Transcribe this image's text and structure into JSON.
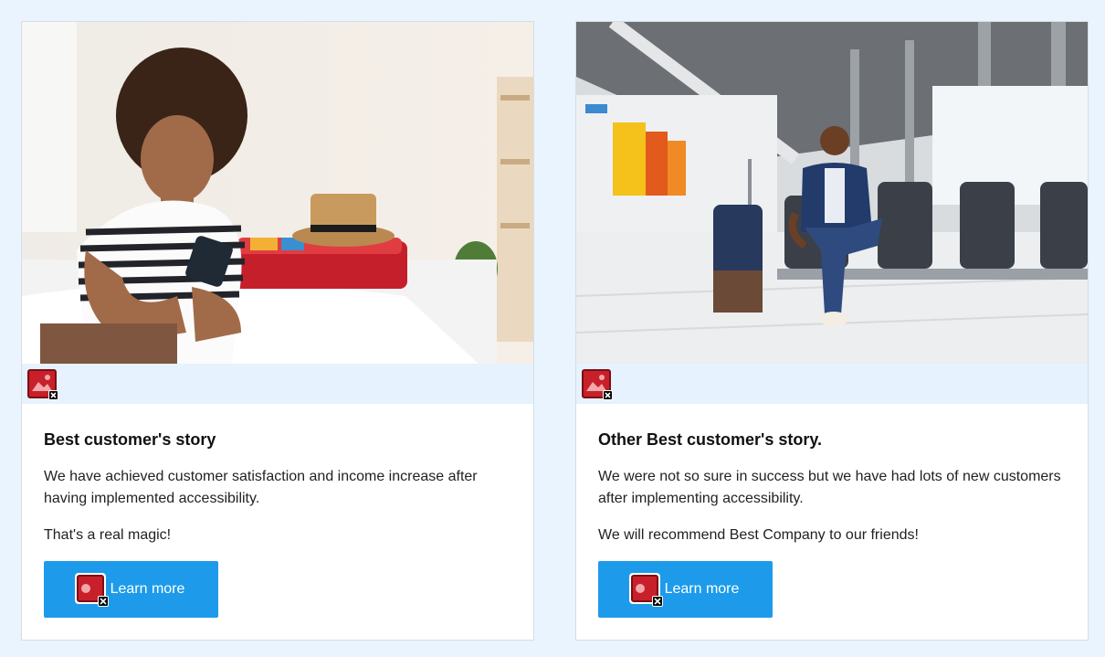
{
  "cards": [
    {
      "title": "Best customer's story",
      "paragraphs": [
        "We have achieved customer satisfaction and income increase after having implemented accessibility.",
        "That's a real magic!"
      ],
      "button_label": "Learn more",
      "photo_icon": "woman-on-bed-with-phone-photo",
      "broken_icon": "broken-image-icon"
    },
    {
      "title": "Other Best customer's story.",
      "paragraphs": [
        "We were not so sure in success but we have had lots of new customers after implementing accessibility.",
        "We will recommend Best Company to our friends!"
      ],
      "button_label": "Learn more",
      "photo_icon": "man-at-airport-on-phone-photo",
      "broken_icon": "broken-image-icon"
    }
  ],
  "colors": {
    "page_background": "#e9f4fe",
    "button": "#1d9bea",
    "broken_strip": "#e6f2fd"
  }
}
